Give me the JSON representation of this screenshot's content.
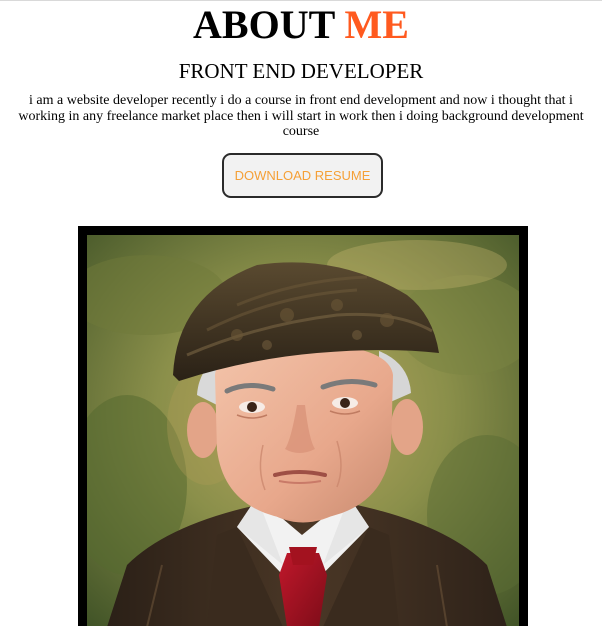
{
  "header": {
    "title_main": "ABOUT",
    "title_accent": "ME",
    "subtitle": "FRONT END DEVELOPER"
  },
  "bio": {
    "text": "i am a website developer recently i do a course in front end development and now i thought that i working in any freelance market place then i will start in work then i doing background development course"
  },
  "resume_button": {
    "label": "DOWNLOAD RESUME"
  },
  "portrait": {
    "icon": "portrait-photo"
  },
  "colors": {
    "accent": "#ff5a1f",
    "button_text": "#f5a037",
    "frame": "#000000"
  }
}
